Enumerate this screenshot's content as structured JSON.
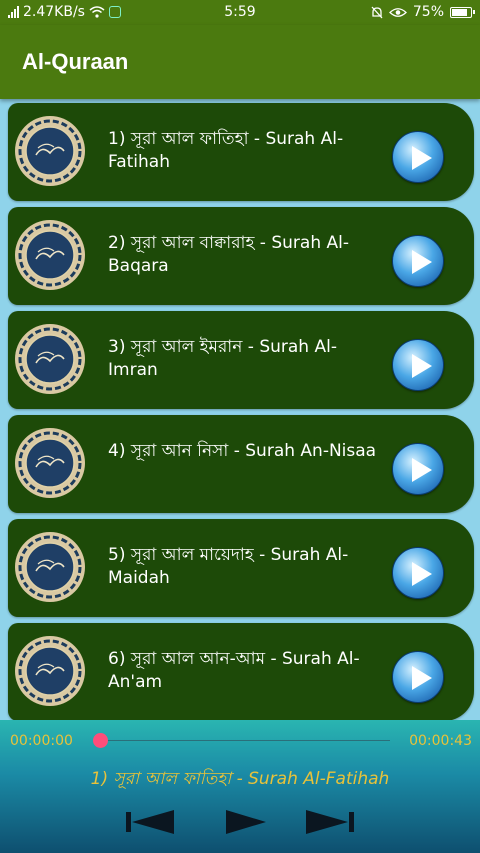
{
  "status": {
    "network_speed": "2.47KB/s",
    "time": "5:59",
    "battery": "75%"
  },
  "appbar": {
    "title": "Al-Quraan"
  },
  "surahs": [
    {
      "label": "1) সূরা আল ফাতিহা - Surah Al-Fatihah"
    },
    {
      "label": "2) সূরা আল বাক্বারাহ - Surah Al-Baqara"
    },
    {
      "label": "3) সূরা আল ইমরান - Surah Al-Imran"
    },
    {
      "label": "4) সূরা আন নিসা - Surah An-Nisaa"
    },
    {
      "label": "5) সূরা আল মায়েদাহ - Surah Al-Maidah"
    },
    {
      "label": "6) সূরা আল আন-আম - Surah Al-An'am"
    }
  ],
  "player": {
    "current_time": "00:00:00",
    "total_time": "00:00:43",
    "progress": 0,
    "now_playing": "1) সূরা আল ফাতিহা - Surah Al-Fatihah"
  },
  "icons": {
    "emblem": "quran-emblem-icon",
    "play": "play-icon",
    "previous": "skip-previous-icon",
    "next": "skip-next-icon"
  },
  "colors": {
    "appbar": "#4b7a0f",
    "row": "#1d4a08",
    "background": "#8fd3ea",
    "accent_text": "#e8c23a",
    "seek_thumb": "#ff4d7a"
  }
}
